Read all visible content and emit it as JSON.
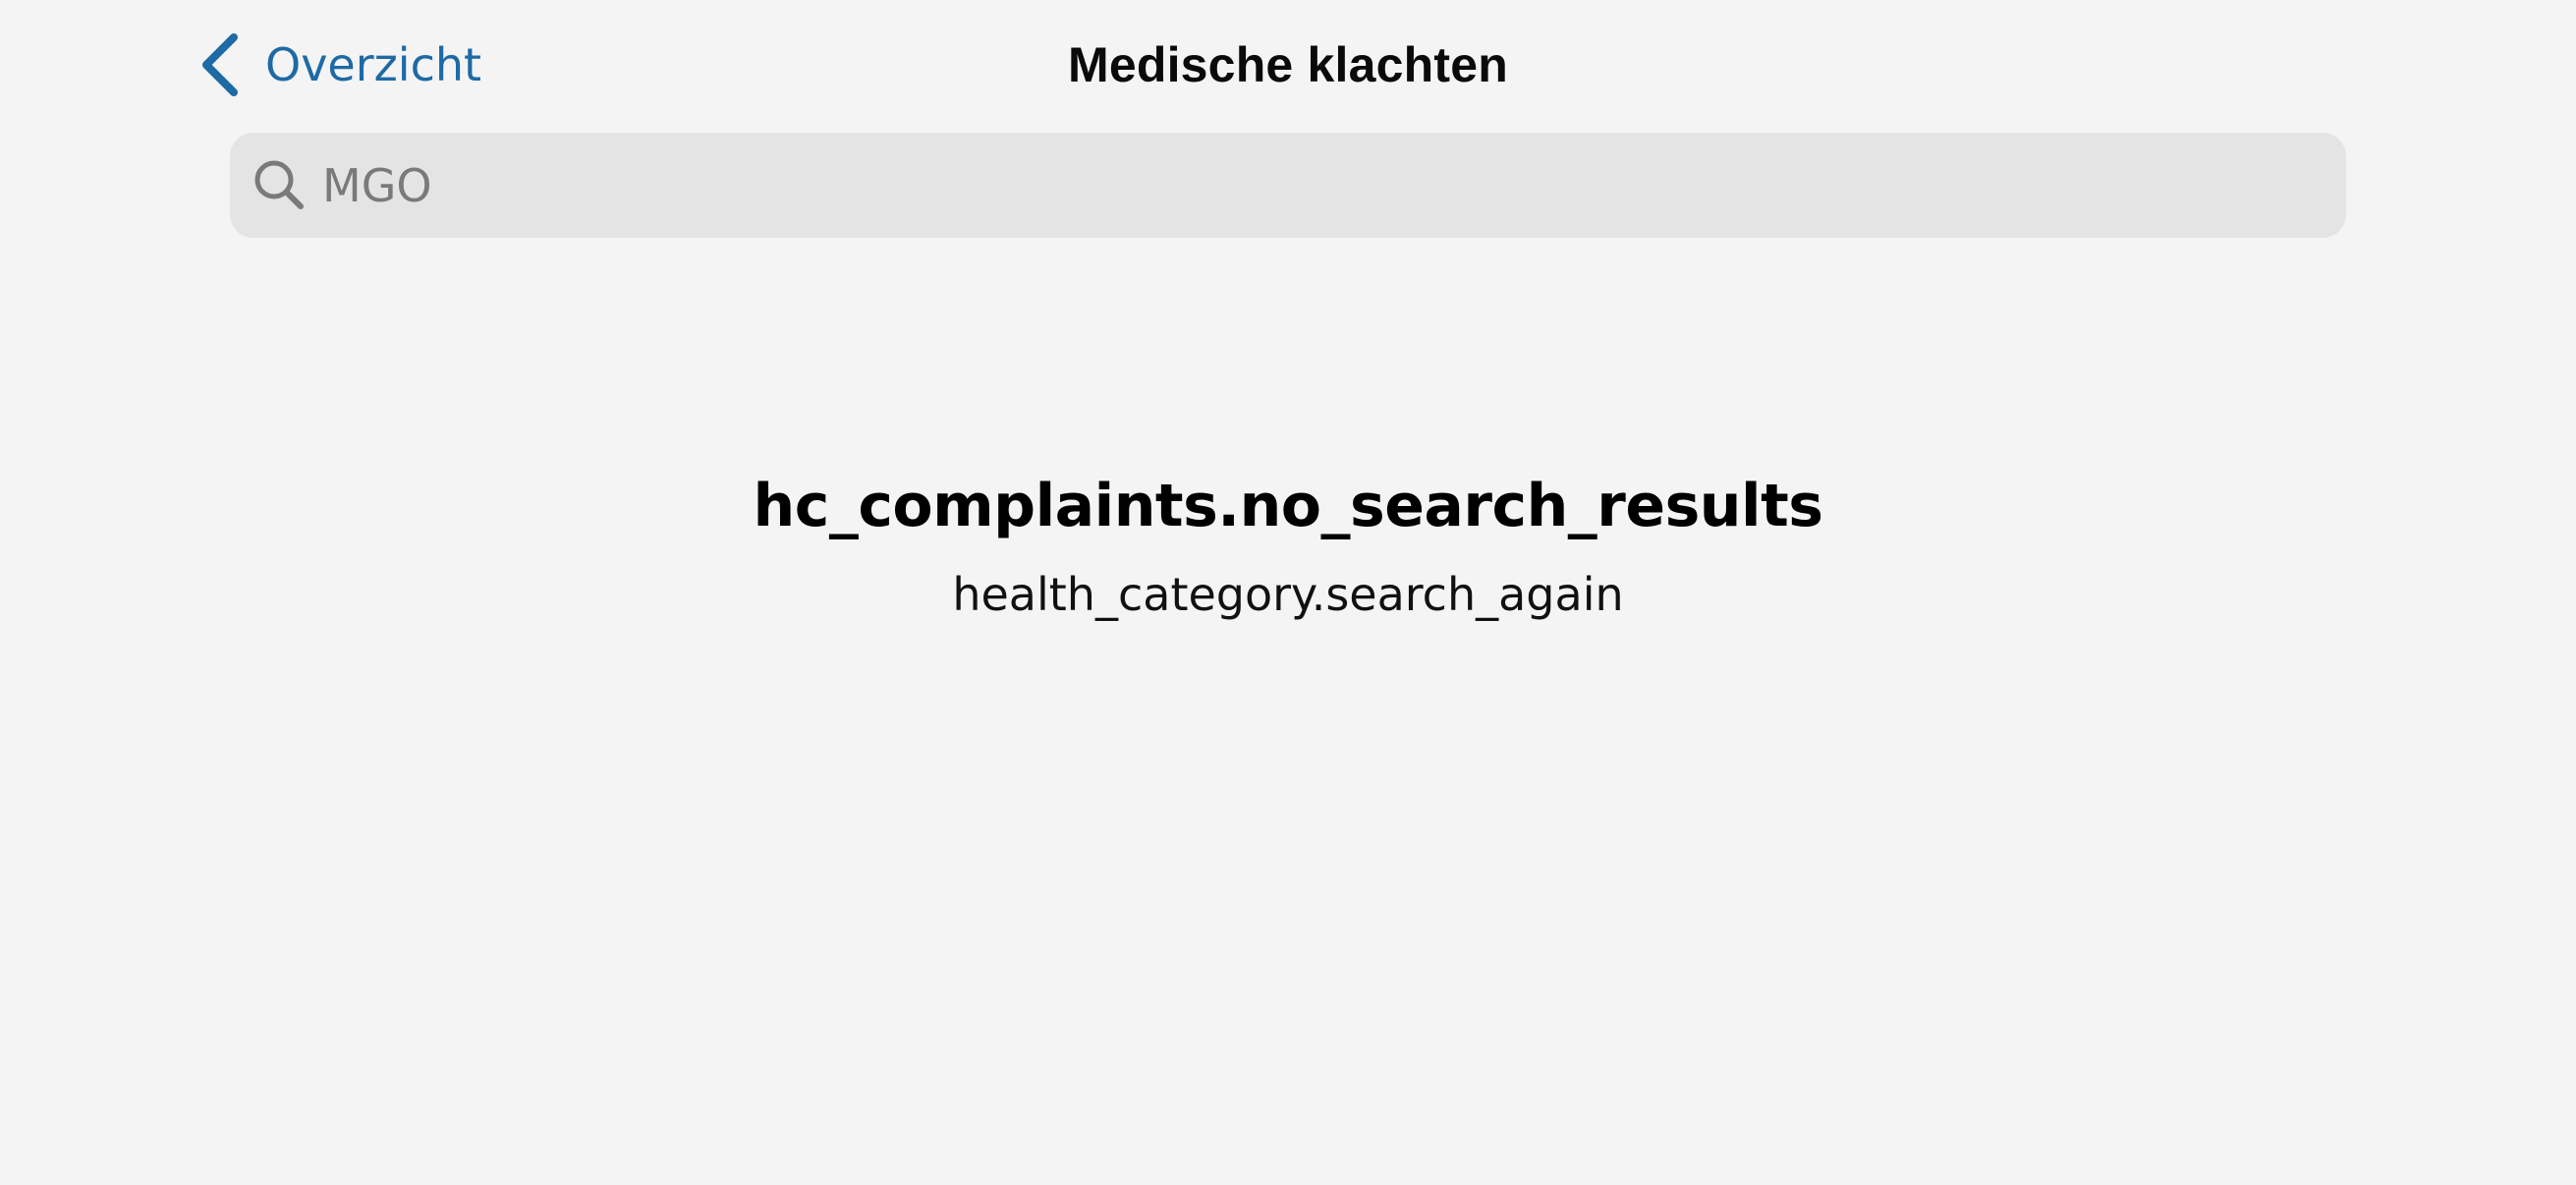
{
  "nav": {
    "back_label": "Overzicht",
    "back_icon": "chevron-left-icon",
    "title": "Medische klachten",
    "accent_color": "#1d6aa5"
  },
  "search": {
    "icon": "search-icon",
    "placeholder": "MGO",
    "value": ""
  },
  "empty_state": {
    "title": "hc_complaints.no_search_results",
    "subtitle": "health_category.search_again"
  }
}
